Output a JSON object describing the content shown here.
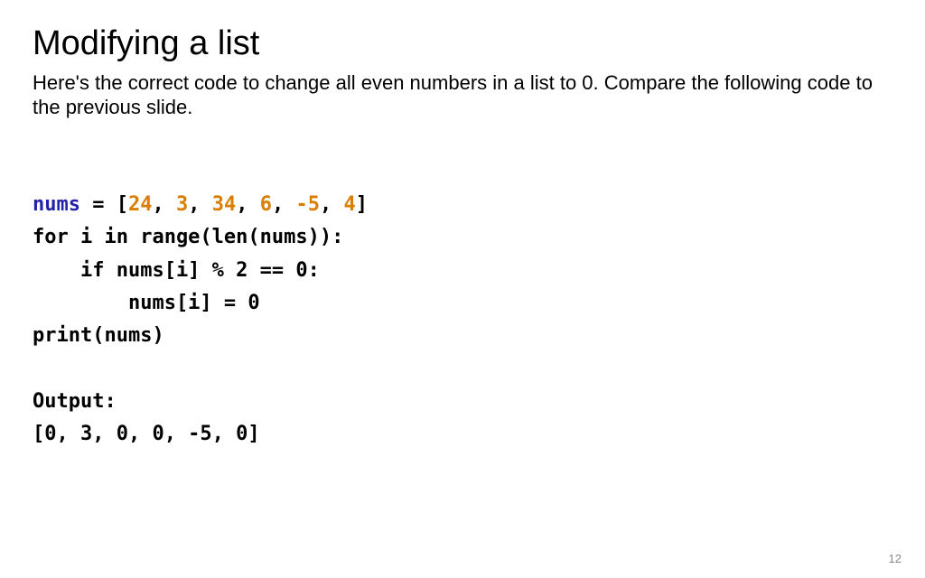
{
  "title": "Modifying a list",
  "description": "Here's the correct code to change all even numbers in a list to 0. Compare the following code to the previous slide.",
  "code": {
    "line1_kw": "nums",
    "line1_rest_a": " = [",
    "line1_n1": "24",
    "line1_c1": ", ",
    "line1_n2": "3",
    "line1_c2": ", ",
    "line1_n3": "34",
    "line1_c3": ", ",
    "line1_n4": "6",
    "line1_c4": ", ",
    "line1_n5": "-5",
    "line1_c5": ", ",
    "line1_n6": "4",
    "line1_rest_b": "]",
    "line2": "for i in range(len(nums)):",
    "line3": "    if nums[i] % 2 == 0:",
    "line4": "        nums[i] = 0",
    "line5": "print(nums)",
    "blank": "",
    "line6": "Output:",
    "line7": "[0, 3, 0, 0, -5, 0]"
  },
  "page_number": "12"
}
